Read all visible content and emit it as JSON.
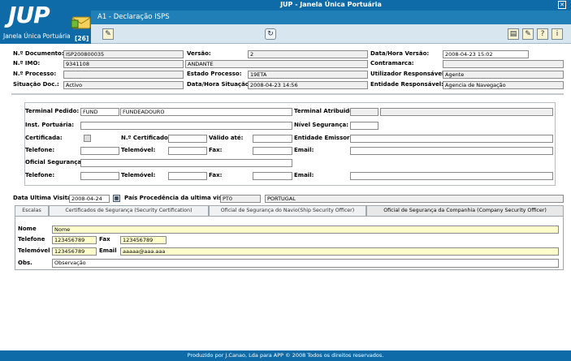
{
  "app": {
    "logo": "JUP",
    "logo_sub": "Janela Única Portuária",
    "title": "JUP - Janela Única Portuária",
    "doc_title": "A1 - Declaração ISPS",
    "badge": "[26]",
    "footer": "Produzido por J.Canao, Lda para APP © 2008 Todos os direitos reservados."
  },
  "header": {
    "n_documento": {
      "label": "N.º Documento:",
      "value": "ISP200800035"
    },
    "versao": {
      "label": "Versão:",
      "value": "2"
    },
    "data_hora_versao": {
      "label": "Data/Hora Versão:",
      "value": "2008-04-23 15:02"
    },
    "n_imo": {
      "label": "N.º IMO:",
      "value": "9341108"
    },
    "navio": {
      "value": "ANDANTE"
    },
    "contramarca": {
      "label": "Contramarca:",
      "value": ""
    },
    "n_processo": {
      "label": "N.º Processo:",
      "value": ""
    },
    "estado_processo": {
      "label": "Estado Processo:",
      "value": "19ETA"
    },
    "utilizador_responsavel": {
      "label": "Utilizador Responsável:",
      "value": "Agente"
    },
    "situacao_doc": {
      "label": "Situação Doc.:",
      "value": "Activo"
    },
    "data_hora_situacao": {
      "label": "Data/Hora Situação:",
      "value": "2008-04-23 14:56"
    },
    "entidade_responsavel": {
      "label": "Entidade Responsável:",
      "value": "Agencia de Navegação"
    }
  },
  "terminal": {
    "terminal_pedido": {
      "label": "Terminal Pedido:",
      "code": "FUND",
      "name": "FUNDEADOURO"
    },
    "terminal_atribuido": {
      "label": "Terminal Atribuido:",
      "code": "",
      "name": ""
    },
    "inst_portuaria": {
      "label": "Inst. Portuária:",
      "value": ""
    },
    "nivel_seguranca": {
      "label": "Nível Segurança:",
      "value": ""
    },
    "certificada": {
      "label": "Certificada:"
    },
    "n_certificado": {
      "label": "N.º Certificado:",
      "value": ""
    },
    "valido_ate": {
      "label": "Válido até:",
      "value": ""
    },
    "entidade_emissora": {
      "label": "Entidade Emissora:",
      "value": ""
    },
    "telefone1": {
      "label": "Telefone:",
      "value": ""
    },
    "telemovel1": {
      "label": "Telemóvel:",
      "value": ""
    },
    "fax1": {
      "label": "Fax:",
      "value": ""
    },
    "email1": {
      "label": "Email:",
      "value": ""
    },
    "oficial_seguranca": {
      "label": "Oficial Segurança:",
      "value": ""
    },
    "telefone2": {
      "label": "Telefone:",
      "value": ""
    },
    "telemovel2": {
      "label": "Telemóvel:",
      "value": ""
    },
    "fax2": {
      "label": "Fax:",
      "value": ""
    },
    "email2": {
      "label": "Email:",
      "value": ""
    }
  },
  "visita": {
    "data_ultima_visita": {
      "label": "Data Ultima Visita:",
      "value": "2008-04-24"
    },
    "pais_procedencia": {
      "label": "País Procedência da ultima visita:",
      "code": "PT0",
      "name": "PORTUGAL"
    }
  },
  "tabs": [
    {
      "label": "Escalas"
    },
    {
      "label": "Certificados de Segurança (Security Certification)"
    },
    {
      "label": "Oficial de Segurança do Navio(Ship Security Officer)"
    },
    {
      "label": "Oficial de Segurança da Companhia (Company Security Officer)"
    }
  ],
  "cso": {
    "nome": {
      "label": "Nome",
      "value": "Nome"
    },
    "telefone": {
      "label": "Telefone",
      "value": "123456789"
    },
    "fax": {
      "label": "Fax",
      "value": "123456789"
    },
    "telemovel": {
      "label": "Telemóvel",
      "value": "123456789"
    },
    "email": {
      "label": "Email",
      "value": "aaaaa@aaa.aaa"
    },
    "obs": {
      "label": "Obs.",
      "value": "Observação"
    }
  }
}
